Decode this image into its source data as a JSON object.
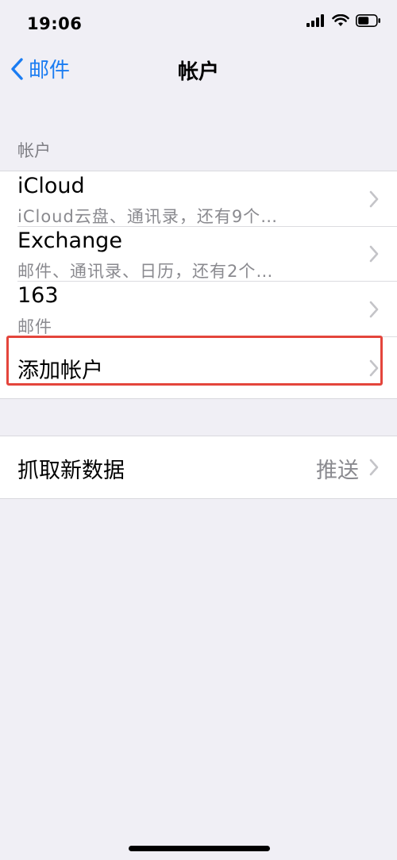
{
  "status_bar": {
    "time": "19:06",
    "icons": [
      "signal-icon",
      "wifi-icon",
      "battery-icon"
    ]
  },
  "nav": {
    "back_label": "邮件",
    "title": "帐户"
  },
  "accounts_section": {
    "header": "帐户",
    "items": [
      {
        "title": "iCloud",
        "subtitle": "iCloud云盘、通讯录，还有9个…"
      },
      {
        "title": "Exchange",
        "subtitle": "邮件、通讯录、日历，还有2个…"
      },
      {
        "title": "163",
        "subtitle": "邮件"
      }
    ],
    "add_account_label": "添加帐户"
  },
  "fetch_section": {
    "title": "抓取新数据",
    "value": "推送"
  },
  "colors": {
    "accent": "#1a7cf2",
    "highlight": "#e4453c",
    "background": "#f0eff5"
  }
}
